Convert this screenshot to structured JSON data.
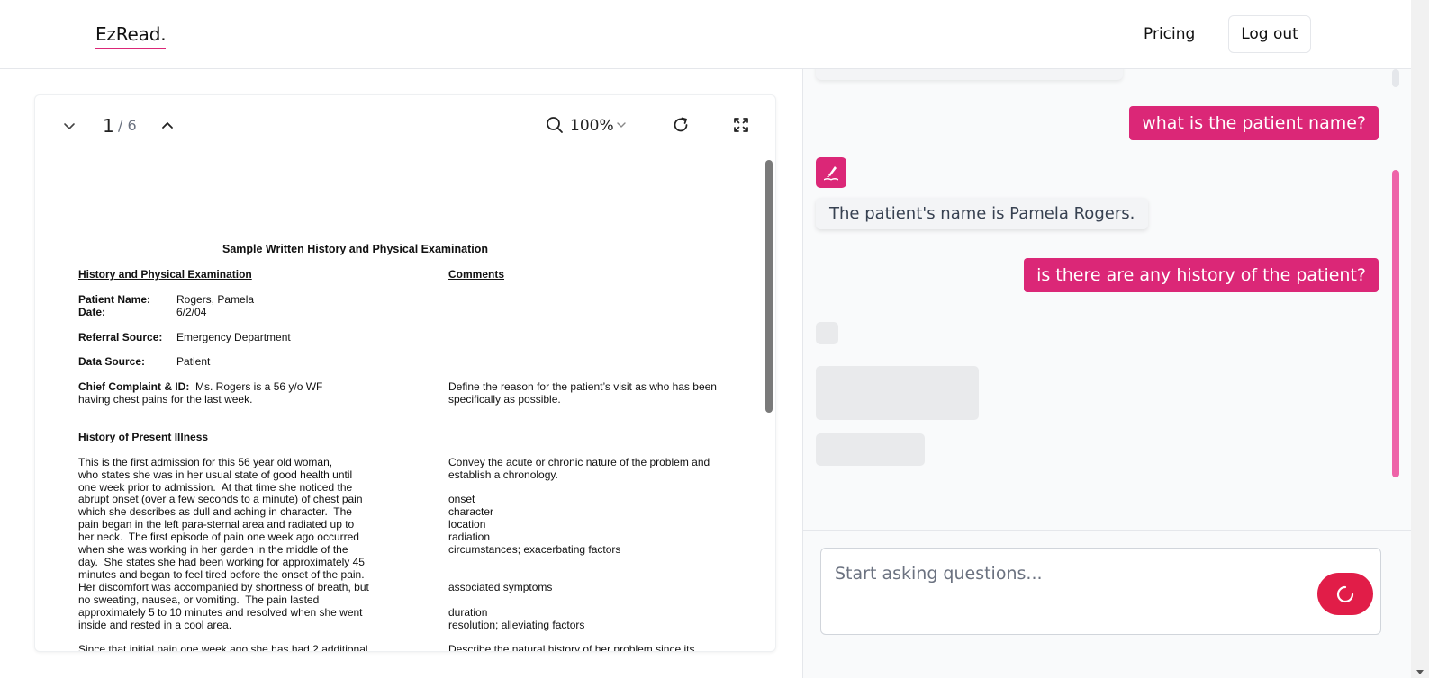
{
  "app": {
    "logo": "EzRead."
  },
  "nav": {
    "pricing": "Pricing",
    "logout": "Log out"
  },
  "pdf_toolbar": {
    "current_page": "1",
    "total_pages": "/ 6",
    "zoom": "100%"
  },
  "document": {
    "title": "Sample Written History and Physical Examination",
    "left_heading": "History and Physical Examination",
    "right_heading": "Comments",
    "patient_name_label": "Patient Name:",
    "patient_name": "Rogers, Pamela",
    "date_label": "Date:",
    "date": "6/2/04",
    "referral_label": "Referral Source:",
    "referral": "Emergency Department",
    "data_source_label": "Data Source:",
    "data_source": "Patient",
    "chief_label": "Chief Complaint & ID:",
    "chief_text_1": "Ms. Rogers is a 56 y/o WF",
    "chief_text_2": "having chest pains for the last week.",
    "chief_comment_1": "Define the reason for the patient’s visit as who has been",
    "chief_comment_2": "specifically as possible.",
    "hpi_heading": "History of Present Illness",
    "hpi_lines": [
      "This is the first admission for this 56 year old woman,",
      "who states she was in her usual state of good health until",
      "one week prior to admission.  At that time she noticed the",
      "abrupt onset (over a few seconds to a minute) of chest pain",
      "which she describes as dull and aching in character.  The",
      "pain began in the left para-sternal area and radiated up to",
      "her neck.  The first episode of pain one week ago occurred",
      "when she was working in her garden in the middle of the",
      "day.  She states she had been working for approximately 45",
      "minutes and began to feel tired before the onset of the pain.",
      "Her discomfort was accompanied by shortness of breath, but",
      "no sweating, nausea, or vomiting.  The pain lasted",
      "approximately 5 to 10 minutes and resolved when she went",
      "inside and rested in a cool area."
    ],
    "hpi_comment_1": "Convey the acute or chronic nature of the problem and",
    "hpi_comment_2": "establish a chronology.",
    "comment_onset": "onset",
    "comment_character": "character",
    "comment_location": "location",
    "comment_radiation": "radiation",
    "comment_circumstances": "circumstances; exacerbating factors",
    "comment_associated": "associated symptoms",
    "comment_duration": "duration",
    "comment_resolution": "resolution; alleviating factors",
    "last_line_left": "Since that initial pain one week ago she has had 2 additional",
    "last_line_right": "Describe the natural history of her problem since its"
  },
  "chat": {
    "user_msg_1": "what is the patient name?",
    "bot_msg_1": "The patient's name is Pamela Rogers.",
    "user_msg_2": "is there are any history of the patient?",
    "input_placeholder": "Start asking questions..."
  },
  "colors": {
    "accent": "#db2777",
    "send_button": "#e11d48"
  }
}
